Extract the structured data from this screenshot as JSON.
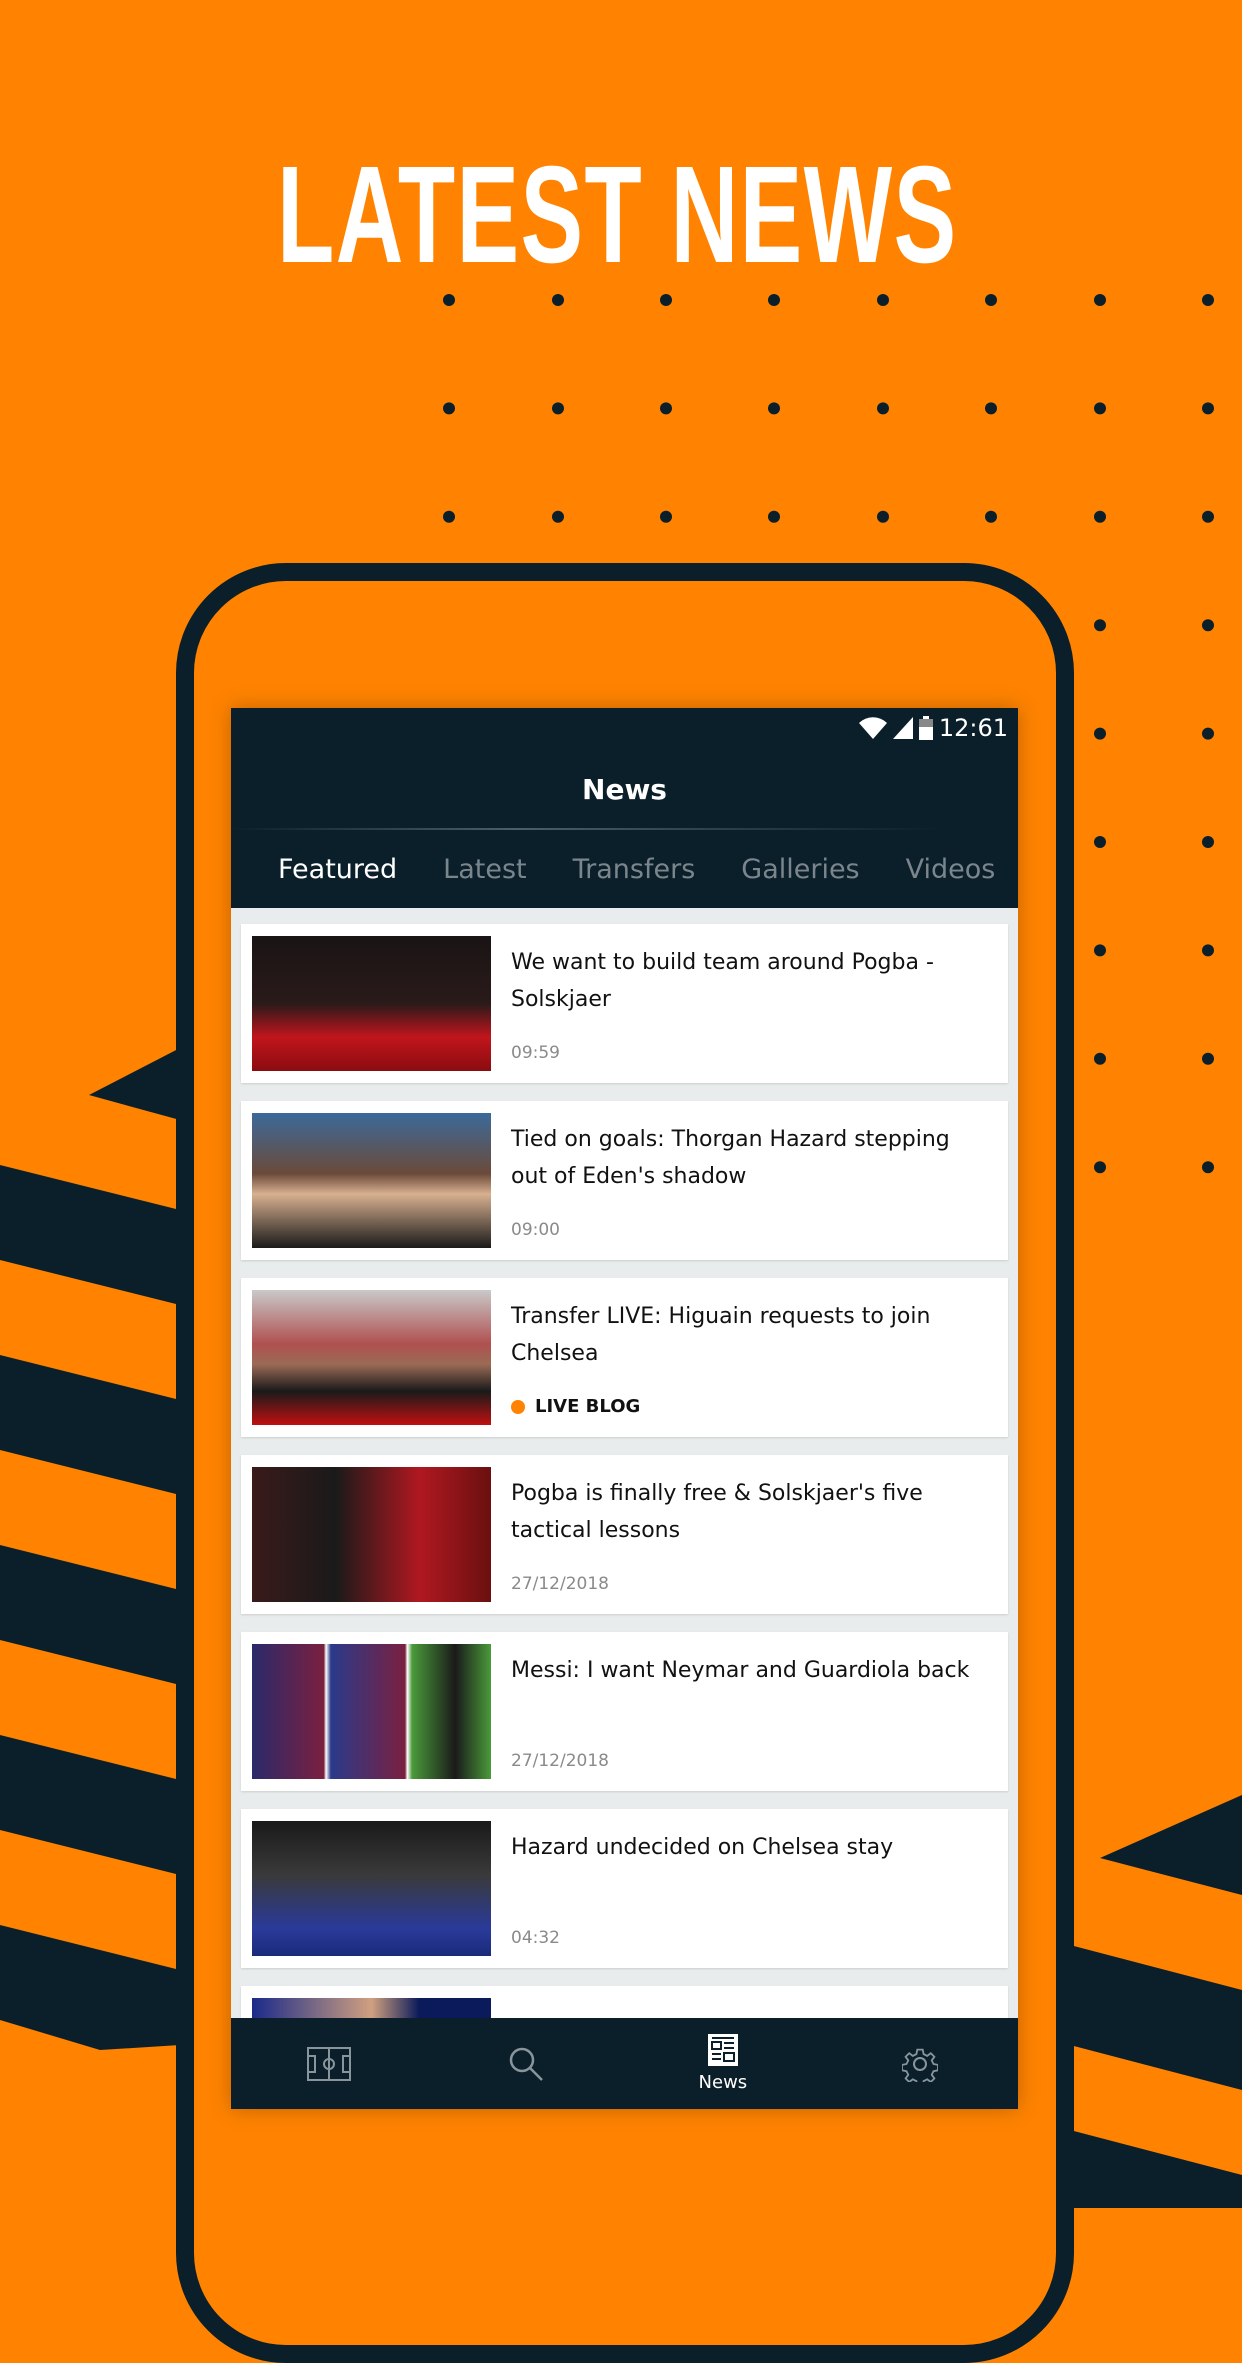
{
  "promo": {
    "headline": "LATEST NEWS"
  },
  "colors": {
    "orange": "#FF8300",
    "navy": "#0B1F2B"
  },
  "status_bar": {
    "time": "12:61",
    "icons": [
      "wifi-icon",
      "signal-icon",
      "battery-icon"
    ]
  },
  "header": {
    "title": "News"
  },
  "tabs": [
    {
      "label": "Featured",
      "active": true
    },
    {
      "label": "Latest"
    },
    {
      "label": "Transfers"
    },
    {
      "label": "Galleries"
    },
    {
      "label": "Videos"
    }
  ],
  "articles": [
    {
      "title": "We want to build team around Pogba - Solskjaer",
      "meta": "09:59"
    },
    {
      "title": "Tied on goals: Thorgan Hazard stepping out of Eden's shadow",
      "meta": "09:00"
    },
    {
      "title": "Transfer LIVE: Higuain requests to join Chelsea",
      "meta": "LIVE BLOG"
    },
    {
      "title": "Pogba is finally free & Solskjaer's five tactical lessons",
      "meta": "27/12/2018"
    },
    {
      "title": "Messi: I want Neymar and Guardiola back",
      "meta": "27/12/2018"
    },
    {
      "title": "Hazard undecided on Chelsea stay",
      "meta": "04:32"
    }
  ],
  "bottom_nav": [
    {
      "icon": "pitch-icon"
    },
    {
      "icon": "search-icon"
    },
    {
      "icon": "news-icon",
      "label": "News",
      "active": true
    },
    {
      "icon": "gear-icon"
    }
  ]
}
